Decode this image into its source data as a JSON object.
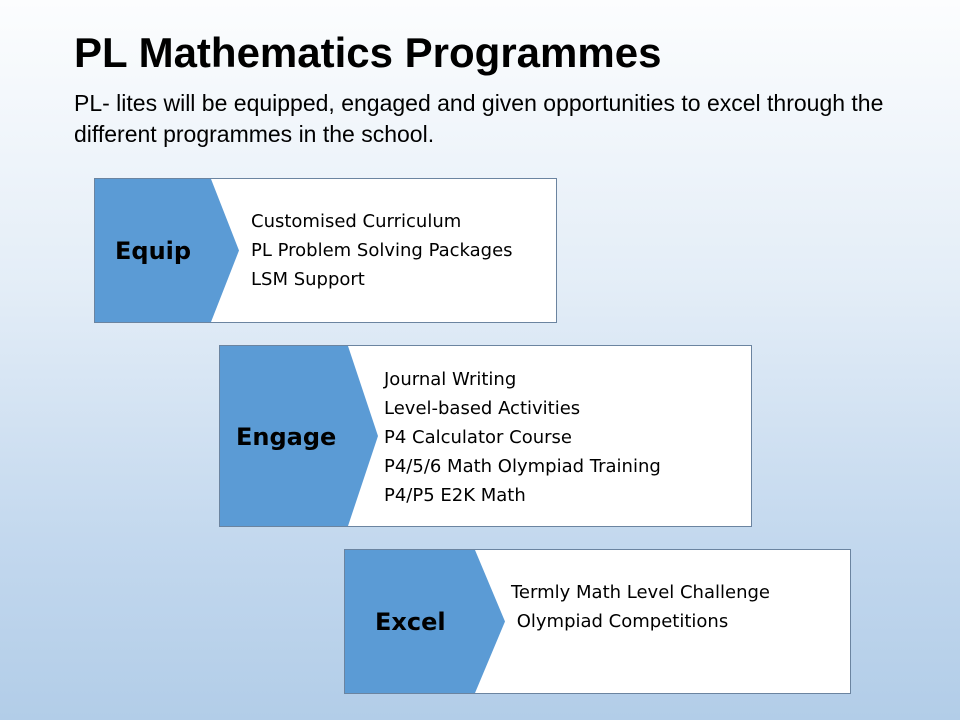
{
  "slide": {
    "title": "PL Mathematics Programmes",
    "subtitle": "PL- lites will be equipped, engaged  and given opportunities to excel through the different programmes in the school."
  },
  "colors": {
    "chevron_fill": "#5b9bd5",
    "box_border": "#6b84a0",
    "background_top": "#fcfdfe",
    "background_bottom": "#b2cde8"
  },
  "programmes": [
    {
      "label": "Equip",
      "items": [
        "Customised Curriculum",
        "PL Problem Solving Packages",
        "LSM Support"
      ]
    },
    {
      "label": "Engage",
      "items": [
        "Journal Writing",
        "Level-based Activities",
        "P4 Calculator Course",
        "P4/5/6  Math Olympiad Training",
        "P4/P5  E2K Math"
      ]
    },
    {
      "label": "Excel",
      "items": [
        "Termly Math  Level Challenge",
        " Olympiad Competitions"
      ]
    }
  ]
}
